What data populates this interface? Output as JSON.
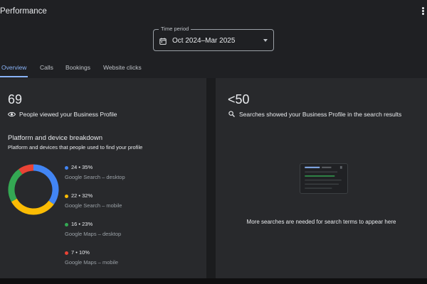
{
  "header": {
    "title": "Performance"
  },
  "time_period": {
    "label": "Time period",
    "value": "Oct 2024–Mar 2025"
  },
  "tabs": [
    {
      "label": "Overview",
      "active": true
    },
    {
      "label": "Calls",
      "active": false
    },
    {
      "label": "Bookings",
      "active": false
    },
    {
      "label": "Website clicks",
      "active": false
    }
  ],
  "left_panel": {
    "count": "69",
    "caption": "People viewed your Business Profile",
    "breakdown_title": "Platform and device breakdown",
    "breakdown_subtitle": "Platform and devices that people used to find your profile",
    "legend": [
      {
        "value": "24 • 35%",
        "label": "Google Search – desktop",
        "color": "#4285f4"
      },
      {
        "value": "22 • 32%",
        "label": "Google Search – mobile",
        "color": "#fbbc04"
      },
      {
        "value": "16 • 23%",
        "label": "Google Maps – desktop",
        "color": "#34a853"
      },
      {
        "value": "7 • 10%",
        "label": "Google Maps – mobile",
        "color": "#ea4335"
      }
    ]
  },
  "right_panel": {
    "count": "<50",
    "caption": "Searches showed your Business Profile in the search results",
    "empty_message": "More searches are needed for search terms to appear here"
  },
  "chart_data": {
    "type": "pie",
    "categories": [
      "Google Search – desktop",
      "Google Search – mobile",
      "Google Maps – desktop",
      "Google Maps – mobile"
    ],
    "values": [
      35,
      32,
      23,
      10
    ],
    "colors": [
      "#4285f4",
      "#fbbc04",
      "#34a853",
      "#ea4335"
    ]
  }
}
